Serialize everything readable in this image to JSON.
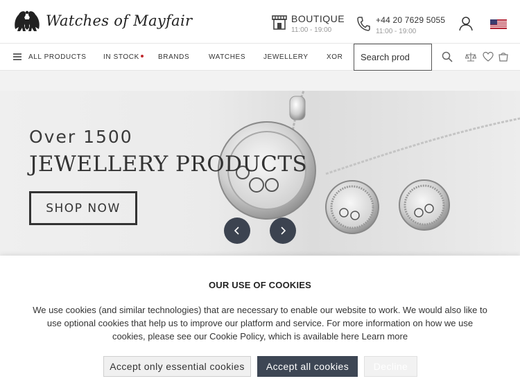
{
  "brand": {
    "name": "Watches of Mayfair"
  },
  "header": {
    "boutique_label": "BOUTIQUE",
    "boutique_hours": "11:00 - 19:00",
    "phone_number": "+44 20 7629 5055",
    "phone_hours": "11:00 - 19:00",
    "user_icon": "user-icon",
    "store_icon": "store-icon",
    "phone_icon": "phone-icon",
    "flag": "us-flag-icon"
  },
  "nav": {
    "items": [
      {
        "label": "ALL PRODUCTS"
      },
      {
        "label": "IN STOCK"
      },
      {
        "label": "BRANDS"
      },
      {
        "label": "WATCHES"
      },
      {
        "label": "JEWELLERY"
      },
      {
        "label": "XOR"
      }
    ],
    "search_placeholder": "Search prod",
    "icons": [
      "search-icon",
      "compare-scales-icon",
      "heart-icon",
      "cart-icon"
    ],
    "in_stock_dot_color": "#c0282d"
  },
  "hero": {
    "line1": "Over 1500",
    "line2": "JEWELLERY PRODUCTS",
    "cta": "SHOP NOW",
    "prev_icon": "chevron-left-icon",
    "next_icon": "chevron-right-icon"
  },
  "cookies": {
    "title": "OUR USE OF COOKIES",
    "text": "We use cookies (and similar technologies) that are necessary to enable our website to work. We would also like to use optional cookies that help us to improve our platform and service. For more information on how we use cookies, please see our Cookie Policy, which is available here",
    "learn_more": "Learn more",
    "btn_essential": "Accept only essential cookies",
    "btn_all": "Accept all cookies",
    "btn_decline": "Decline"
  },
  "colors": {
    "accent_dark": "#3d4654",
    "text": "#333333",
    "red_dot": "#c0282d"
  }
}
